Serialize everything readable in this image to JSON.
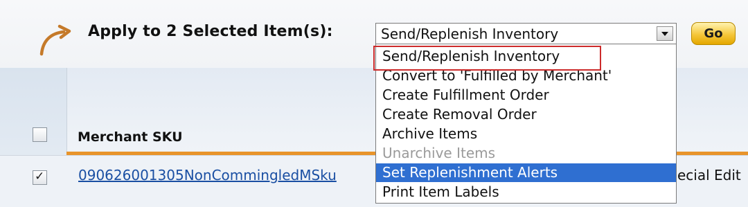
{
  "toolbar": {
    "apply_label": "Apply to 2 Selected Item(s):",
    "action_select_value": "Send/Replenish Inventory",
    "go_label": "Go"
  },
  "action_options": [
    {
      "label": "Send/Replenish Inventory",
      "state": "selected"
    },
    {
      "label": "Convert to 'Fulfilled by Merchant'",
      "state": "normal"
    },
    {
      "label": "Create Fulfillment Order",
      "state": "normal"
    },
    {
      "label": "Create Removal Order",
      "state": "normal"
    },
    {
      "label": "Archive Items",
      "state": "normal"
    },
    {
      "label": "Unarchive Items",
      "state": "disabled"
    },
    {
      "label": "Set Replenishment Alerts",
      "state": "hover"
    },
    {
      "label": "Print Item Labels",
      "state": "normal"
    }
  ],
  "table": {
    "header_checkbox_checked": false,
    "column_header": "Merchant SKU",
    "rows": [
      {
        "checked": true,
        "sku": "090626001305NonCommingledMSku",
        "trailing_text": "ecial Edit"
      }
    ]
  },
  "colors": {
    "highlight": "#2f6fd1",
    "annotation": "#cc2b2b",
    "header_underline": "#e8942a",
    "go_button": "#f5c63a",
    "arrow": "#c57a2a"
  },
  "icons": {
    "arrow": "curved-arrow-icon",
    "dropdown": "chevron-down-icon"
  }
}
